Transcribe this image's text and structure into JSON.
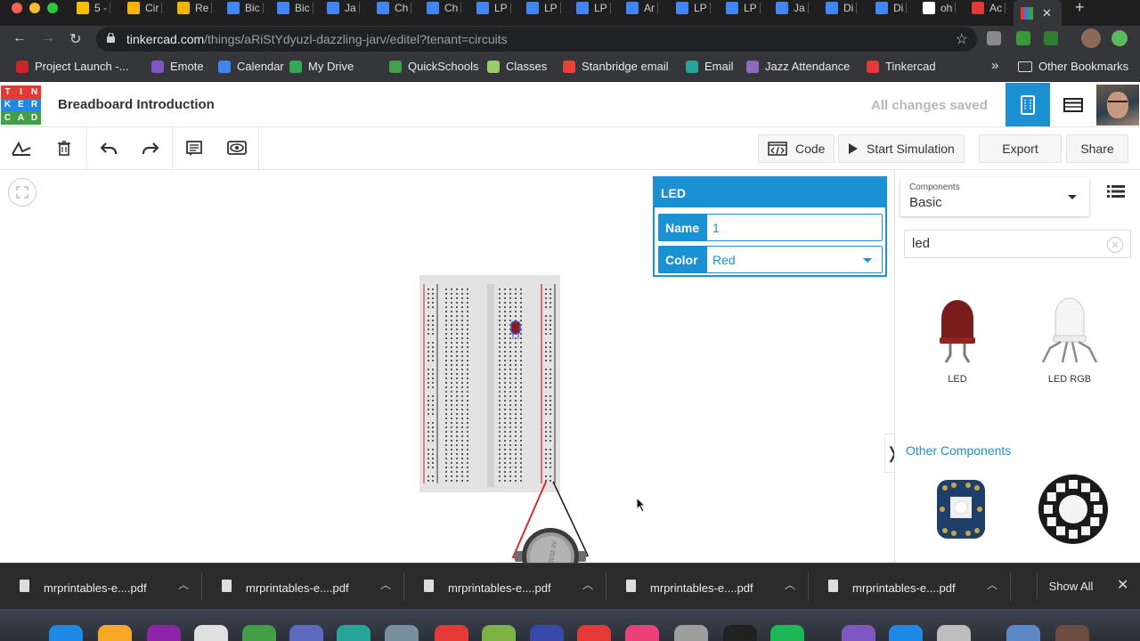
{
  "browser": {
    "tabs": [
      {
        "label": "5 -",
        "color": "#fbbc04"
      },
      {
        "label": "Cir",
        "color": "#f4b400"
      },
      {
        "label": "Re",
        "color": "#f4b400"
      },
      {
        "label": "Bic",
        "color": "#4285f4"
      },
      {
        "label": "Bic",
        "color": "#4285f4"
      },
      {
        "label": "Ja",
        "color": "#4285f4"
      },
      {
        "label": "Ch",
        "color": "#4285f4"
      },
      {
        "label": "Ch",
        "color": "#4285f4"
      },
      {
        "label": "LP",
        "color": "#4285f4"
      },
      {
        "label": "LP",
        "color": "#4285f4"
      },
      {
        "label": "LP",
        "color": "#4285f4"
      },
      {
        "label": "Ar",
        "color": "#4285f4"
      },
      {
        "label": "LP",
        "color": "#4285f4"
      },
      {
        "label": "LP",
        "color": "#4285f4"
      },
      {
        "label": "Ja",
        "color": "#4285f4"
      },
      {
        "label": "Di",
        "color": "#4285f4"
      },
      {
        "label": "Di",
        "color": "#4285f4"
      },
      {
        "label": "oh",
        "color": "#ffffff"
      },
      {
        "label": "Ac",
        "color": "#e53935"
      }
    ],
    "url_host": "tinkercad.com",
    "url_path": "/things/aRiStYdyuzl-dazzling-jarv/editel?tenant=circuits",
    "bookmarks": [
      {
        "label": "Project Launch -...",
        "color": "#c62828"
      },
      {
        "label": "Emote",
        "color": "#7e57c2"
      },
      {
        "label": "Calendar",
        "color": "#4285f4"
      },
      {
        "label": "My Drive",
        "color": "#34a853"
      },
      {
        "label": "QuickSchools",
        "color": "#43a047"
      },
      {
        "label": "Classes",
        "color": "#9ccc65"
      },
      {
        "label": "Stanbridge email",
        "color": "#ea4335"
      },
      {
        "label": "Email",
        "color": "#26a69a"
      },
      {
        "label": "Jazz Attendance",
        "color": "#8e6bbf"
      },
      {
        "label": "Tinkercad",
        "color": "#e53935"
      }
    ],
    "bookmarks_overflow": "»",
    "other_bookmarks": "Other Bookmarks"
  },
  "app": {
    "logo_letters": [
      "T",
      "I",
      "N",
      "K",
      "E",
      "R",
      "C",
      "A",
      "D"
    ],
    "title": "Breadboard Introduction",
    "save_status": "All changes saved",
    "toolbar": {
      "code_label": "Code",
      "start_simulation_label": "Start Simulation",
      "export_label": "Export",
      "share_label": "Share"
    },
    "inspector": {
      "title": "LED",
      "name_label": "Name",
      "name_value": "1",
      "color_label": "Color",
      "color_value": "Red"
    },
    "panel": {
      "components_caption": "Components",
      "components_value": "Basic",
      "search_value": "led",
      "results": [
        {
          "label": "LED"
        },
        {
          "label": "LED RGB"
        }
      ],
      "other_components_title": "Other Components"
    },
    "battery_text": "CR2032 3V"
  },
  "downloads": {
    "items": [
      {
        "name": "mrprintables-e....pdf"
      },
      {
        "name": "mrprintables-e....pdf"
      },
      {
        "name": "mrprintables-e....pdf"
      },
      {
        "name": "mrprintables-e....pdf"
      },
      {
        "name": "mrprintables-e....pdf"
      }
    ],
    "show_all": "Show All"
  }
}
